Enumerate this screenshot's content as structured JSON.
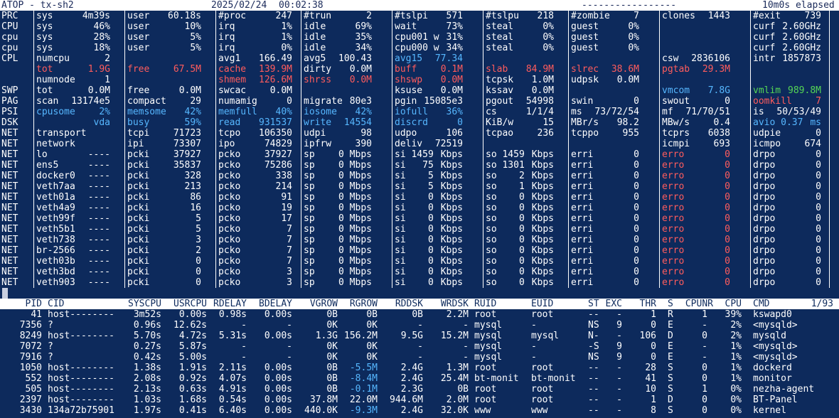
{
  "title": {
    "left": "ATOP - tx-sh2",
    "date": "2025/02/24",
    "time": "00:02:38",
    "dashes": "-----------------",
    "elapsed": "10m0s elapsed"
  },
  "rows": [
    {
      "label": "PRC",
      "cells": [
        [
          "sys",
          "4m39s"
        ],
        [
          "user",
          "60.18s"
        ],
        [
          "#proc",
          "247"
        ],
        [
          "#trun",
          "2"
        ],
        [
          "#tslpi",
          "571"
        ],
        [
          "#tslpu",
          "218"
        ],
        [
          "#zombie",
          "7"
        ],
        [
          "clones",
          "1443"
        ],
        [
          "#exit",
          "739"
        ]
      ]
    },
    {
      "label": "CPU",
      "cells": [
        [
          "sys",
          "46%"
        ],
        [
          "user",
          "10%"
        ],
        [
          "irq",
          "1%"
        ],
        [
          "idle",
          "69%"
        ],
        [
          "wait",
          "73%"
        ],
        [
          "steal",
          "0%"
        ],
        [
          "guest",
          "0%"
        ],
        [
          "",
          ""
        ],
        [
          "curf",
          "2.60GHz"
        ]
      ]
    },
    {
      "label": "cpu",
      "cells": [
        [
          "sys",
          "28%"
        ],
        [
          "user",
          "5%"
        ],
        [
          "irq",
          "1%"
        ],
        [
          "idle",
          "35%"
        ],
        [
          "cpu001 w",
          "31%"
        ],
        [
          "steal",
          "0%"
        ],
        [
          "guest",
          "0%"
        ],
        [
          "",
          ""
        ],
        [
          "curf",
          "2.60GHz"
        ]
      ]
    },
    {
      "label": "cpu",
      "cells": [
        [
          "sys",
          "18%"
        ],
        [
          "user",
          "5%"
        ],
        [
          "irq",
          "0%"
        ],
        [
          "idle",
          "34%"
        ],
        [
          "cpu000 w",
          "34%"
        ],
        [
          "steal",
          "0%"
        ],
        [
          "guest",
          "0%"
        ],
        [
          "",
          ""
        ],
        [
          "curf",
          "2.60GHz"
        ]
      ]
    },
    {
      "label": "CPL",
      "cells": [
        [
          "numcpu",
          "2"
        ],
        [
          "",
          ""
        ],
        [
          "avg1",
          "166.49"
        ],
        [
          "avg5",
          "100.43"
        ],
        [
          "avg15",
          "77.34",
          "cy"
        ],
        [
          "",
          ""
        ],
        [
          "",
          ""
        ],
        [
          "csw",
          "2836106"
        ],
        [
          "intr",
          "1857873"
        ]
      ]
    },
    {
      "label": "",
      "cells": [
        [
          "tot",
          "1.9G",
          "red"
        ],
        [
          "free",
          "67.5M",
          "red"
        ],
        [
          "cache",
          "139.9M",
          "red"
        ],
        [
          "dirty",
          "0.0M"
        ],
        [
          "buff",
          "0.1M",
          "red"
        ],
        [
          "slab",
          "84.9M",
          "red"
        ],
        [
          "slrec",
          "38.6M",
          "red"
        ],
        [
          "pgtab",
          "29.3M",
          "red"
        ],
        [
          "",
          ""
        ]
      ]
    },
    {
      "label": "",
      "cells": [
        [
          "numnode",
          "1"
        ],
        [
          "",
          ""
        ],
        [
          "shmem",
          "126.6M",
          "red"
        ],
        [
          "shrss",
          "0.0M",
          "red"
        ],
        [
          "shswp",
          "0.0M",
          "red"
        ],
        [
          "tcpsk",
          "1.0M"
        ],
        [
          "udpsk",
          "0.0M"
        ],
        [
          "",
          ""
        ],
        [
          "",
          ""
        ]
      ]
    },
    {
      "label": "SWP",
      "cells": [
        [
          "tot",
          "0.0M"
        ],
        [
          "free",
          "0.0M"
        ],
        [
          "swcac",
          "0.0M"
        ],
        [
          "",
          ""
        ],
        [
          "ksuse",
          "0.0M"
        ],
        [
          "kssav",
          "0.0M"
        ],
        [
          "",
          ""
        ],
        [
          "vmcom",
          "7.8G",
          "cy"
        ],
        [
          "vmlim",
          "989.8M",
          "gr"
        ]
      ]
    },
    {
      "label": "PAG",
      "cells": [
        [
          "scan",
          "13174e5"
        ],
        [
          "compact",
          "29"
        ],
        [
          "numamig",
          "0"
        ],
        [
          "migrate",
          "80e3"
        ],
        [
          "pgin",
          "15085e3"
        ],
        [
          "pgout",
          "54998"
        ],
        [
          "swin",
          "0"
        ],
        [
          "swout",
          "0"
        ],
        [
          "oomkill",
          "7",
          "red"
        ]
      ]
    },
    {
      "label": "PSI",
      "cells": [
        [
          "cpusome",
          "2%",
          "cy"
        ],
        [
          "memsome",
          "42%",
          "cy"
        ],
        [
          "memfull",
          "40%",
          "cy"
        ],
        [
          "iosome",
          "42%",
          "cy"
        ],
        [
          "iofull",
          "36%",
          "cy"
        ],
        [
          "cs",
          "1/1/4"
        ],
        [
          "ms",
          "73/72/54"
        ],
        [
          "mf",
          "71/70/51"
        ],
        [
          "is",
          "50/53/49"
        ]
      ]
    },
    {
      "label": "DSK",
      "cells": [
        [
          "",
          "vda",
          "cy"
        ],
        [
          "busy",
          "59%",
          "cy"
        ],
        [
          "read",
          "931537",
          "cy"
        ],
        [
          "write",
          "14554",
          "cy"
        ],
        [
          "discrd",
          "0",
          "cy"
        ],
        [
          "KiB/w",
          "15"
        ],
        [
          "MBr/s",
          "98.2"
        ],
        [
          "MBw/s",
          "0.4"
        ],
        [
          "avio 0.37",
          "ms",
          "cy"
        ]
      ]
    },
    {
      "label": "NET",
      "cells": [
        [
          "transport",
          ""
        ],
        [
          "tcpi",
          "71723"
        ],
        [
          "tcpo",
          "106350"
        ],
        [
          "udpi",
          "98"
        ],
        [
          "udpo",
          "106"
        ],
        [
          "tcpao",
          "236"
        ],
        [
          "tcppo",
          "955"
        ],
        [
          "tcprs",
          "6038"
        ],
        [
          "udpie",
          "0"
        ]
      ]
    },
    {
      "label": "NET",
      "cells": [
        [
          "network",
          ""
        ],
        [
          "ipi",
          "73307"
        ],
        [
          "ipo",
          "74829"
        ],
        [
          "ipfrw",
          "390"
        ],
        [
          "deliv",
          "72519"
        ],
        [
          "",
          ""
        ],
        [
          "",
          ""
        ],
        [
          "icmpi",
          "693"
        ],
        [
          "icmpo",
          "674"
        ]
      ]
    },
    {
      "label": "NET",
      "cells": [
        [
          "lo",
          "----"
        ],
        [
          "pcki",
          "37927"
        ],
        [
          "pcko",
          "37927"
        ],
        [
          "sp",
          "0 Mbps"
        ],
        [
          "si 1459",
          "Kbps"
        ],
        [
          "so 1459",
          "Kbps"
        ],
        [
          "erri",
          "0"
        ],
        [
          "erro",
          "0",
          "red"
        ],
        [
          "drpo",
          "0"
        ]
      ]
    },
    {
      "label": "NET",
      "cells": [
        [
          "ens5",
          "----"
        ],
        [
          "pcki",
          "35837"
        ],
        [
          "pcko",
          "75286"
        ],
        [
          "sp",
          "0 Mbps"
        ],
        [
          "si   75",
          "Kbps"
        ],
        [
          "so 1301",
          "Kbps"
        ],
        [
          "erri",
          "0"
        ],
        [
          "erro",
          "0",
          "red"
        ],
        [
          "drpo",
          "0"
        ]
      ]
    },
    {
      "label": "NET",
      "cells": [
        [
          "docker0",
          "----"
        ],
        [
          "pcki",
          "328"
        ],
        [
          "pcko",
          "338"
        ],
        [
          "sp",
          "0 Mbps"
        ],
        [
          "si    5",
          "Kbps"
        ],
        [
          "so    2",
          "Kbps"
        ],
        [
          "erri",
          "0"
        ],
        [
          "erro",
          "0",
          "red"
        ],
        [
          "drpo",
          "0"
        ]
      ]
    },
    {
      "label": "NET",
      "cells": [
        [
          "veth7aa",
          "----"
        ],
        [
          "pcki",
          "213"
        ],
        [
          "pcko",
          "214"
        ],
        [
          "sp",
          "0 Mbps"
        ],
        [
          "si    5",
          "Kbps"
        ],
        [
          "so    1",
          "Kbps"
        ],
        [
          "erri",
          "0"
        ],
        [
          "erro",
          "0",
          "red"
        ],
        [
          "drpo",
          "0"
        ]
      ]
    },
    {
      "label": "NET",
      "cells": [
        [
          "veth01a",
          "----"
        ],
        [
          "pcki",
          "86"
        ],
        [
          "pcko",
          "91"
        ],
        [
          "sp",
          "0 Mbps"
        ],
        [
          "si    0",
          "Kbps"
        ],
        [
          "so    0",
          "Kbps"
        ],
        [
          "erri",
          "0"
        ],
        [
          "erro",
          "0",
          "red"
        ],
        [
          "drpo",
          "0"
        ]
      ]
    },
    {
      "label": "NET",
      "cells": [
        [
          "veth4a9",
          "----"
        ],
        [
          "pcki",
          "16"
        ],
        [
          "pcko",
          "19"
        ],
        [
          "sp",
          "0 Mbps"
        ],
        [
          "si    0",
          "Kbps"
        ],
        [
          "so    0",
          "Kbps"
        ],
        [
          "erri",
          "0"
        ],
        [
          "erro",
          "0",
          "red"
        ],
        [
          "drpo",
          "0"
        ]
      ]
    },
    {
      "label": "NET",
      "cells": [
        [
          "veth99f",
          "----"
        ],
        [
          "pcki",
          "5"
        ],
        [
          "pcko",
          "17"
        ],
        [
          "sp",
          "0 Mbps"
        ],
        [
          "si    0",
          "Kbps"
        ],
        [
          "so    0",
          "Kbps"
        ],
        [
          "erri",
          "0"
        ],
        [
          "erro",
          "0",
          "red"
        ],
        [
          "drpo",
          "0"
        ]
      ]
    },
    {
      "label": "NET",
      "cells": [
        [
          "veth5b1",
          "----"
        ],
        [
          "pcki",
          "5"
        ],
        [
          "pcko",
          "7"
        ],
        [
          "sp",
          "0 Mbps"
        ],
        [
          "si    0",
          "Kbps"
        ],
        [
          "so    0",
          "Kbps"
        ],
        [
          "erri",
          "0"
        ],
        [
          "erro",
          "0",
          "red"
        ],
        [
          "drpo",
          "0"
        ]
      ]
    },
    {
      "label": "NET",
      "cells": [
        [
          "veth738",
          "----"
        ],
        [
          "pcki",
          "3"
        ],
        [
          "pcko",
          "7"
        ],
        [
          "sp",
          "0 Mbps"
        ],
        [
          "si    0",
          "Kbps"
        ],
        [
          "so    0",
          "Kbps"
        ],
        [
          "erri",
          "0"
        ],
        [
          "erro",
          "0",
          "red"
        ],
        [
          "drpo",
          "0"
        ]
      ]
    },
    {
      "label": "NET",
      "cells": [
        [
          "br-2566",
          "----"
        ],
        [
          "pcki",
          "2"
        ],
        [
          "pcko",
          "7"
        ],
        [
          "sp",
          "0 Mbps"
        ],
        [
          "si    0",
          "Kbps"
        ],
        [
          "so    0",
          "Kbps"
        ],
        [
          "erri",
          "0"
        ],
        [
          "erro",
          "0",
          "red"
        ],
        [
          "drpo",
          "0"
        ]
      ]
    },
    {
      "label": "NET",
      "cells": [
        [
          "veth03b",
          "----"
        ],
        [
          "pcki",
          "0"
        ],
        [
          "pcko",
          "7"
        ],
        [
          "sp",
          "0 Mbps"
        ],
        [
          "si    0",
          "Kbps"
        ],
        [
          "so    0",
          "Kbps"
        ],
        [
          "erri",
          "0"
        ],
        [
          "erro",
          "0",
          "red"
        ],
        [
          "drpo",
          "0"
        ]
      ]
    },
    {
      "label": "NET",
      "cells": [
        [
          "veth3bd",
          "----"
        ],
        [
          "pcki",
          "0"
        ],
        [
          "pcko",
          "3"
        ],
        [
          "sp",
          "0 Mbps"
        ],
        [
          "si    0",
          "Kbps"
        ],
        [
          "so    0",
          "Kbps"
        ],
        [
          "erri",
          "0"
        ],
        [
          "erro",
          "0",
          "red"
        ],
        [
          "drpo",
          "0"
        ]
      ]
    },
    {
      "label": "NET",
      "cells": [
        [
          "veth903",
          "----"
        ],
        [
          "pcki",
          "0"
        ],
        [
          "pcko",
          "3"
        ],
        [
          "sp",
          "0 Mbps"
        ],
        [
          "si    0",
          "Kbps"
        ],
        [
          "so    0",
          "Kbps"
        ],
        [
          "erri",
          "0"
        ],
        [
          "erro",
          "0",
          "red"
        ],
        [
          "drpo",
          "0"
        ]
      ]
    }
  ],
  "proc_header": [
    "PID",
    "CID",
    "SYSCPU",
    "USRCPU",
    "RDELAY",
    "BDELAY",
    "VGROW",
    "RGROW",
    "RDDSK",
    "WRDSK",
    "RUID",
    "EUID",
    "ST",
    "EXC",
    "THR",
    "S",
    "CPUNR",
    "CPU",
    "CMD",
    "1/93"
  ],
  "processes": [
    [
      "41",
      "host--------",
      "3m52s",
      "0.00s",
      "0.98s",
      "0.00s",
      "0B",
      "0B",
      "0B",
      "2.2M",
      "root",
      "root",
      "--",
      "-",
      "1",
      "R",
      "1",
      "39%",
      "kswapd0"
    ],
    [
      "7356",
      "?",
      "0.96s",
      "12.62s",
      "-",
      "-",
      "0K",
      "0K",
      "-",
      "-",
      "mysql",
      "-",
      "NS",
      "9",
      "0",
      "E",
      "-",
      "2%",
      "<mysqld>"
    ],
    [
      "8249",
      "host--------",
      "5.70s",
      "4.72s",
      "5.31s",
      "0.00s",
      "1.3G",
      "156.2M",
      "9.5G",
      "15.2M",
      "mysql",
      "mysql",
      "N-",
      "-",
      "106",
      "D",
      "0",
      "2%",
      "mysqld"
    ],
    [
      "7072",
      "?",
      "0.27s",
      "5.87s",
      "-",
      "-",
      "0K",
      "0K",
      "-",
      "-",
      "mysql",
      "-",
      "-S",
      "9",
      "0",
      "E",
      "-",
      "1%",
      "<mysqld>"
    ],
    [
      "7916",
      "?",
      "0.42s",
      "5.00s",
      "-",
      "-",
      "0K",
      "0K",
      "-",
      "-",
      "mysql",
      "-",
      "NS",
      "9",
      "0",
      "E",
      "-",
      "1%",
      "<mysqld>"
    ],
    [
      "1050",
      "host--------",
      "1.38s",
      "1.91s",
      "2.11s",
      "0.00s",
      "0B",
      "-5.5M",
      "2.4G",
      "1.3M",
      "root",
      "root",
      "--",
      "-",
      "28",
      "S",
      "0",
      "1%",
      "dockerd"
    ],
    [
      "552",
      "host--------",
      "2.08s",
      "0.92s",
      "4.07s",
      "0.00s",
      "0B",
      "-8.4M",
      "2.4G",
      "25.4M",
      "bt-monit",
      "bt-monit",
      "--",
      "-",
      "41",
      "S",
      "0",
      "1%",
      "monitor"
    ],
    [
      "505",
      "host--------",
      "2.13s",
      "0.63s",
      "4.91s",
      "0.00s",
      "0B",
      "-0.1M",
      "2.3G",
      "0B",
      "root",
      "root",
      "--",
      "-",
      "10",
      "S",
      "1",
      "0%",
      "nezha-agent"
    ],
    [
      "2397",
      "host--------",
      "1.03s",
      "1.68s",
      "0.54s",
      "0.00s",
      "37.8M",
      "22.0M",
      "944.6M",
      "2.0M",
      "root",
      "root",
      "--",
      "-",
      "1",
      "D",
      "0",
      "0%",
      "BT-Panel"
    ],
    [
      "3430",
      "134a72b75901",
      "1.97s",
      "0.41s",
      "6.40s",
      "0.00s",
      "440.0K",
      "-9.3M",
      "2.4G",
      "32.0K",
      "www",
      "www",
      "--",
      "-",
      "8",
      "S",
      "0",
      "0%",
      "kernel"
    ]
  ],
  "colors": {
    "background": "#0d2a5c",
    "foreground": "#ffffff",
    "red": "#ff5c5c",
    "cyan": "#56b7ff",
    "green": "#55d655"
  }
}
